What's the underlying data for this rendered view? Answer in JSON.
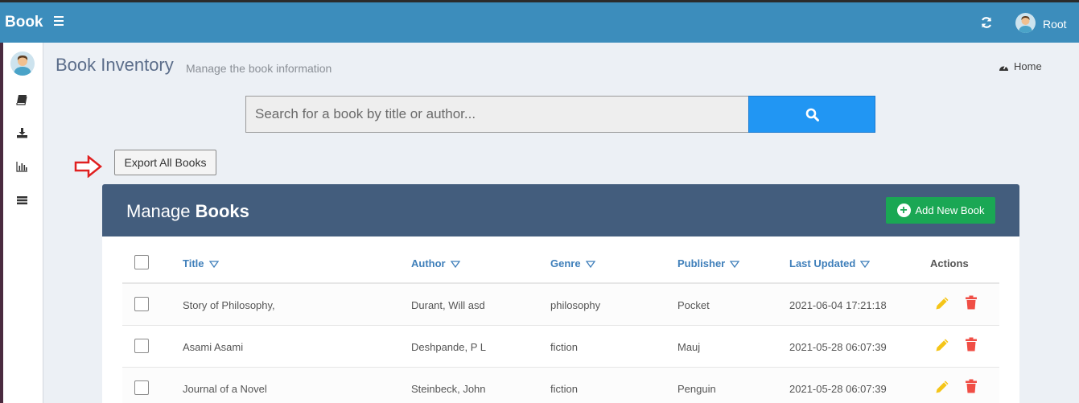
{
  "app": {
    "brand": "Book",
    "user": "Root"
  },
  "header": {
    "title": "Book Inventory",
    "subtitle": "Manage the book information",
    "home_label": "Home"
  },
  "search": {
    "placeholder": "Search for a book by title or author..."
  },
  "export_label": "Export All Books",
  "manage": {
    "title_prefix": "Manage",
    "title_bold": "Books",
    "add_label": "Add New Book"
  },
  "table": {
    "columns": [
      "Title",
      "Author",
      "Genre",
      "Publisher",
      "Last Updated",
      "Actions"
    ],
    "rows": [
      {
        "title": "Story of Philosophy,",
        "author": "Durant, Will asd",
        "genre": "philosophy",
        "publisher": "Pocket",
        "updated": "2021-06-04 17:21:18"
      },
      {
        "title": "Asami Asami",
        "author": "Deshpande, P L",
        "genre": "fiction",
        "publisher": "Mauj",
        "updated": "2021-05-28 06:07:39"
      },
      {
        "title": "Journal of a Novel",
        "author": "Steinbeck, John",
        "genre": "fiction",
        "publisher": "Penguin",
        "updated": "2021-05-28 06:07:39"
      }
    ]
  },
  "colors": {
    "topbar": "#3c8dbc",
    "search_button": "#2196f3",
    "manage_header": "#435d7d",
    "add_button": "#1aa754",
    "edit": "#f5c518",
    "delete": "#f04e45"
  },
  "icons": [
    "menu-icon",
    "refresh-icon",
    "avatar",
    "book-icon",
    "download-icon",
    "bar-chart-icon",
    "list-icon",
    "dashboard-icon",
    "search-icon",
    "arrow-right-icon",
    "plus-circle-icon",
    "sort-down-icon",
    "pencil-icon",
    "trash-icon"
  ]
}
